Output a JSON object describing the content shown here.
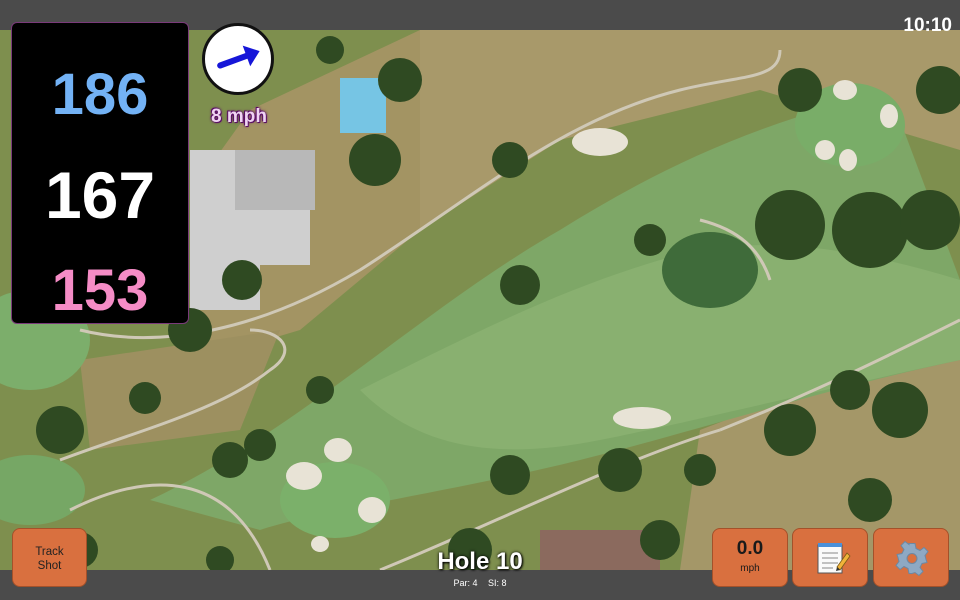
{
  "status_bar": {
    "time": "10:10"
  },
  "distances": {
    "back": "186",
    "center": "167",
    "front": "153"
  },
  "wind": {
    "speed_label": "8 mph",
    "direction": "arrow-icon"
  },
  "buttons": {
    "track_shot_line1": "Track",
    "track_shot_line2": "Shot",
    "wind_value": "0.0",
    "wind_unit": "mph",
    "notes_icon": "notepad-icon",
    "settings_icon": "gear-icon"
  },
  "hole": {
    "title": "Hole 10",
    "par": "Par: 4",
    "si": "SI: 8"
  },
  "colors": {
    "back_distance": "#73b2f5",
    "center_distance": "#ffffff",
    "front_distance": "#f58cc6",
    "button": "#d9703f"
  }
}
